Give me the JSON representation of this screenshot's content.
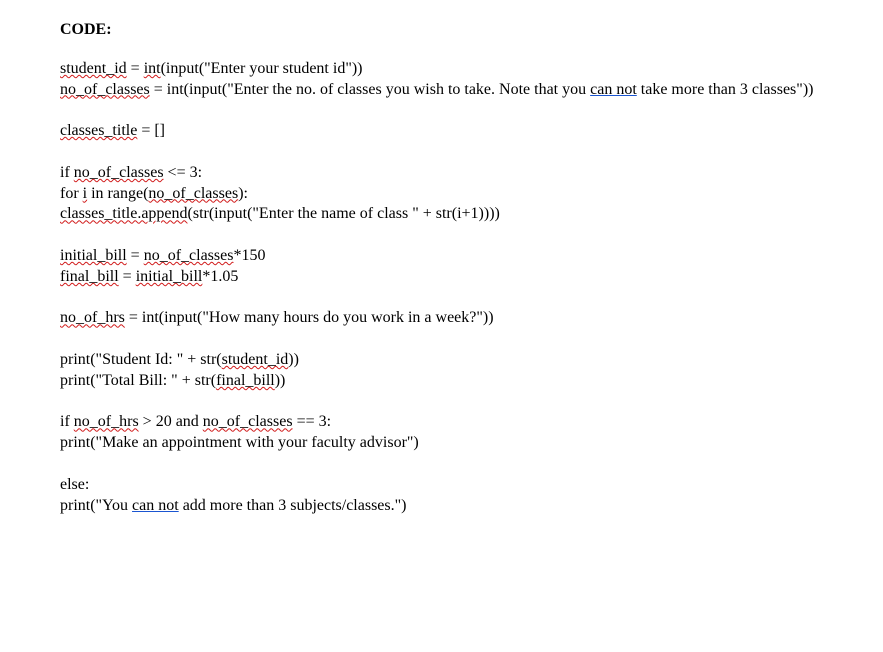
{
  "heading": "CODE:",
  "code": {
    "l1_a": "student_id",
    "l1_b": " = ",
    "l1_c": "int",
    "l1_d": "(input(\"Enter your student id\"))",
    "l2_a": "no_of_classes",
    "l2_b": " = int(input(\"Enter the no. of classes you wish to take. Note that you ",
    "l2_c": "can not",
    "l2_d": " take more than 3 classes\"))",
    "l3_a": "classes_title",
    "l3_b": " = []",
    "l4_a": "if ",
    "l4_b": "no_of_classes",
    "l4_c": " <= 3:",
    "l5_a": "for ",
    "l5_b": "i",
    "l5_c": " in range(",
    "l5_d": "no_of_classes",
    "l5_e": "):",
    "l6_a": "classes_title.append",
    "l6_b": "(str(input(\"Enter the name of class \" + str(i+1))))",
    "l7_a": "initial_bill",
    "l7_b": " = ",
    "l7_c": "no_of_classes",
    "l7_d": "*150",
    "l8_a": "final_bill",
    "l8_b": " = ",
    "l8_c": "initial_bill",
    "l8_d": "*1.05",
    "l9_a": "no_of_hrs",
    "l9_b": " = int(input(\"How many hours do you work in a week?\"))",
    "l10_a": "print(\"Student Id: \" + str(",
    "l10_b": "student_id",
    "l10_c": "))",
    "l11_a": "print(\"Total Bill: \" + str(",
    "l11_b": "final_bill",
    "l11_c": "))",
    "l12_a": "if ",
    "l12_b": "no_of_hrs",
    "l12_c": " > 20 and ",
    "l12_d": "no_of_classes",
    "l12_e": " == 3:",
    "l13": "print(\"Make an appointment with your faculty advisor\")",
    "l14": "else:",
    "l15_a": "print(\"You ",
    "l15_b": "can not",
    "l15_c": " add more than 3 subjects/classes.\")"
  }
}
